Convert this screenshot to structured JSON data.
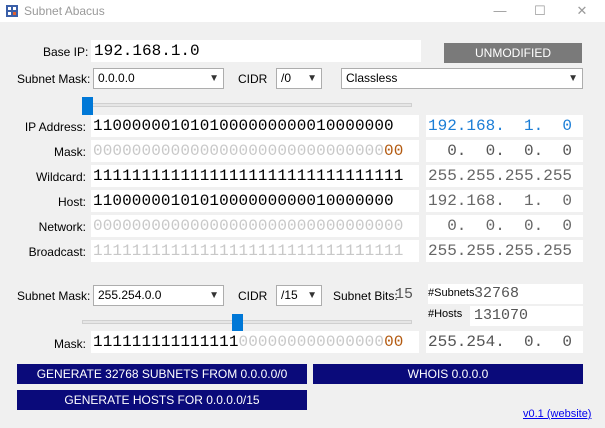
{
  "window": {
    "title": "Subnet Abacus",
    "minimize": "—",
    "maximize": "☐",
    "close": "✕"
  },
  "base": {
    "label": "Base IP:",
    "value": "192.168.1.0",
    "status_button": "UNMODIFIED",
    "mask_label": "Subnet Mask:",
    "mask_value": "0.0.0.0",
    "cidr_label": "CIDR",
    "cidr_value": "/0",
    "class_value": "Classless",
    "slider_fraction": 0.0
  },
  "rows": [
    {
      "label": "IP Address:",
      "bits": [
        "1100000010101000000000010000000",
        ""
      ],
      "decimal": "192.168.  1.  0",
      "bits_style": "normal",
      "dec_style": "blue"
    },
    {
      "label": "Mask:",
      "bits": [
        "000000000000000000000000000000",
        "00"
      ],
      "decimal": "  0.  0.  0.  0",
      "bits_style": "mask",
      "dec_style": "dark"
    },
    {
      "label": "Wildcard:",
      "bits": [
        "11111111111111111111111111111111",
        ""
      ],
      "decimal": "255.255.255.255",
      "bits_style": "normal",
      "dec_style": "gray"
    },
    {
      "label": "Host:",
      "bits": [
        "1100000010101000000000010000000",
        ""
      ],
      "decimal": "192.168.  1.  0",
      "bits_style": "normal",
      "dec_style": "gray"
    },
    {
      "label": "Network:",
      "bits": [
        "00000000000000000000000000000000",
        ""
      ],
      "decimal": "  0.  0.  0.  0",
      "bits_style": "light",
      "dec_style": "gray"
    },
    {
      "label": "Broadcast:",
      "bits": [
        "11111111111111111111111111111111",
        ""
      ],
      "decimal": "255.255.255.255",
      "bits_style": "light",
      "dec_style": "gray"
    }
  ],
  "subnet": {
    "mask_label": "Subnet Mask:",
    "mask_value": "255.254.0.0",
    "cidr_label": "CIDR",
    "cidr_value": "/15",
    "bits_label": "Subnet Bits:",
    "bits_value": "15",
    "subnets_label": "#Subnets",
    "subnets_value": "32768",
    "hosts_label": "#Hosts",
    "hosts_value": "131070",
    "slider_fraction": 0.47,
    "row_label": "Mask:",
    "row_bits_on": "111111111111111",
    "row_bits_off": "000000000000000",
    "row_bits_end": "00",
    "row_decimal": "255.254.  0.  0"
  },
  "buttons": {
    "generate_subnets": "GENERATE 32768 SUBNETS FROM 0.0.0.0/0",
    "whois": "WHOIS 0.0.0.0",
    "generate_hosts": "GENERATE HOSTS FOR 0.0.0.0/15"
  },
  "footer": {
    "version_link": "v0.1 (website)"
  },
  "colors": {
    "accent": "#0078d7",
    "navy_button": "#0a0a7a",
    "unmodified": "#7a7a7a",
    "ip_decimal": "#1a7dd6",
    "mask_tail": "#b35a10"
  }
}
